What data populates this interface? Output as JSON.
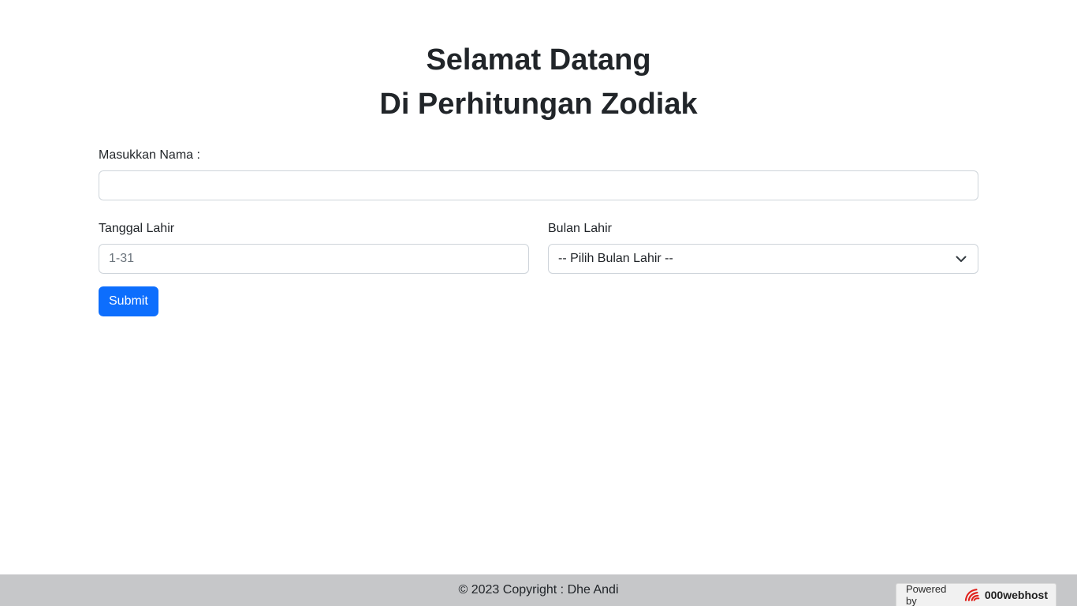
{
  "heading": {
    "line1": "Selamat Datang",
    "line2": "Di Perhitungan Zodiak"
  },
  "form": {
    "name_label": "Masukkan Nama :",
    "name_value": "",
    "date_label": "Tanggal Lahir",
    "date_placeholder": "1-31",
    "month_label": "Bulan Lahir",
    "month_selected": "-- Pilih Bulan Lahir --",
    "submit_label": "Submit"
  },
  "footer": {
    "copyright": "© 2023 Copyright : Dhe Andi"
  },
  "badge": {
    "powered_label": "Powered by",
    "brand": "000webhost"
  },
  "colors": {
    "primary": "#0d6efd",
    "footer_bg": "#c6c7c9",
    "logo_red": "#e0211b"
  }
}
